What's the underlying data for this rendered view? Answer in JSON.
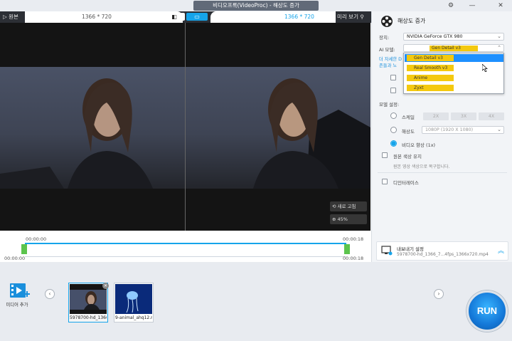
{
  "window": {
    "title": "비디오프록(VideoProc) - 해상도 증가",
    "icons": [
      "gear-icon",
      "minimize-icon",
      "close-icon"
    ]
  },
  "preview": {
    "original_label": "원본",
    "left_resolution": "1366 * 720",
    "right_resolution": "1366 * 720",
    "preview_label": "미리 보기",
    "reset_label": "새로 고침",
    "zoom_label": "45%"
  },
  "timeline": {
    "start_top": "00:00:00",
    "end_top": "00:00:18",
    "start_bottom": "00:00:00",
    "end_bottom": "00:00:18"
  },
  "settings": {
    "title": "해상도 증가",
    "device_label": "장치:",
    "device_value": "NVIDIA GeForce GTX 980",
    "ai_model_label": "AI 모델:",
    "ai_model_value": "Gen Detail v3",
    "info_line1": "더 자세한 D",
    "info_line2": "존들과 노",
    "dropdown_options": [
      "Gen Detail v3",
      "Real Smooth v3",
      "Anime",
      "Zyxt"
    ],
    "model_settings_label": "모델 설정:",
    "scale_label": "스케일",
    "scale_options": [
      "2X",
      "3X",
      "4X"
    ],
    "resolution_label": "해상도",
    "resolution_value": "1080P (1920 X 1080)",
    "video_quality_label": "비디오 향상 (1x)",
    "keep_color_label": "원본 색상 유지",
    "keep_color_desc": "원본 영상 색상으로 복구합니다.",
    "deinterlace_label": "디인터레이스",
    "export_label": "내보내기 설정",
    "export_file": "5978700-hd_1366_7...4fps_1366x720.mp4"
  },
  "media": {
    "add_label": "미디어 추가",
    "files": [
      "5978700-hd_1366",
      "9-animal_ahq12.r"
    ]
  },
  "run_label": "RUN",
  "colors": {
    "accent": "#16a4ea",
    "highlight": "#f4c90f",
    "run": "#1478d8"
  }
}
